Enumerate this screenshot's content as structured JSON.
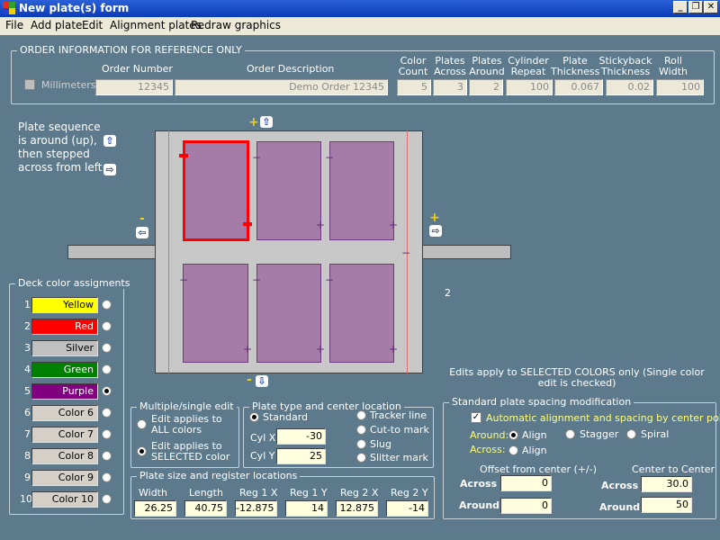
{
  "window": {
    "title": "New plate(s) form",
    "min": "_",
    "max": "❐",
    "close": "✕"
  },
  "menu": [
    "File",
    "Add plate",
    "Edit",
    "Alignment plates",
    "Redraw graphics"
  ],
  "order": {
    "group_title": "ORDER INFORMATION FOR REFERENCE ONLY",
    "millimeters_label": "Millimeters",
    "millimeters_checked": false,
    "order_number_label": "Order Number",
    "order_number": "12345",
    "order_description_label": "Order Description",
    "order_description": "Demo Order 12345",
    "color_count_label": "Color Count",
    "color_count": "5",
    "plates_across_label": "Plates Across",
    "plates_across": "3",
    "plates_around_label": "Plates Around",
    "plates_around": "2",
    "cylinder_repeat_label": "Cylinder Repeat",
    "cylinder_repeat": "100",
    "plate_thickness_label": "Plate Thickness",
    "plate_thickness": "0.067",
    "stickyback_thickness_label": "Stickyback Thickness",
    "stickyback_thickness": "0.02",
    "roll_width_label": "Roll Width",
    "roll_width": "100"
  },
  "sequence_text": [
    "Plate sequence",
    "is around (up),",
    "then stepped",
    "across from left"
  ],
  "canvas": {
    "plus_top": "+",
    "minus_left": "-",
    "plus_right": "+",
    "minus_bottom": "-",
    "side_number": "2"
  },
  "deck": {
    "title": "Deck color assigments",
    "rows": [
      {
        "num": "1",
        "name": "Yellow",
        "color": "#ffff00",
        "text_color": "#000000",
        "selected": false
      },
      {
        "num": "2",
        "name": "Red",
        "color": "#ff0000",
        "text_color": "#ffffff",
        "selected": false
      },
      {
        "num": "3",
        "name": "Silver",
        "color": "#c0c0c0",
        "text_color": "#000000",
        "selected": false
      },
      {
        "num": "4",
        "name": "Green",
        "color": "#008000",
        "text_color": "#ffffff",
        "selected": false
      },
      {
        "num": "5",
        "name": "Purple",
        "color": "#800080",
        "text_color": "#ffffff",
        "selected": true
      },
      {
        "num": "6",
        "name": "Color 6",
        "color": "#d4d0c8",
        "text_color": "#000000",
        "selected": false
      },
      {
        "num": "7",
        "name": "Color 7",
        "color": "#d4d0c8",
        "text_color": "#000000",
        "selected": false
      },
      {
        "num": "8",
        "name": "Color 8",
        "color": "#d4d0c8",
        "text_color": "#000000",
        "selected": false
      },
      {
        "num": "9",
        "name": "Color 9",
        "color": "#d4d0c8",
        "text_color": "#000000",
        "selected": false
      },
      {
        "num": "10",
        "name": "Color 10",
        "color": "#d4d0c8",
        "text_color": "#000000",
        "selected": false
      }
    ]
  },
  "edits_note": "Edits apply to SELECTED COLORS only (Single color edit is checked)",
  "multi_edit": {
    "title": "Multiple/single edit",
    "opt_all": "Edit applies to ALL colors",
    "opt_selected": "Edit applies to SELECTED color",
    "selected": "selected"
  },
  "plate_type": {
    "title": "Plate type and center location",
    "standard": "Standard",
    "tracker": "Tracker line",
    "cut_to_mark": "Cut-to mark",
    "slug": "Slug",
    "slitter": "Slitter mark",
    "cyl_x_label": "Cyl X",
    "cyl_x": "-30",
    "cyl_y_label": "Cyl Y",
    "cyl_y": "25"
  },
  "spacing": {
    "title": "Standard plate spacing modification",
    "auto_label": "Automatic alignment and spacing by center point",
    "auto_checked": true,
    "around_label": "Around:",
    "align": "Align",
    "stagger": "Stagger",
    "spiral": "Spiral",
    "across_label": "Across:",
    "offset_title": "Offset from center  (+/-)",
    "c2c_title": "Center to Center",
    "across": "Across",
    "around": "Around",
    "offset_across": "0",
    "offset_around": "0",
    "c2c_across": "30.0",
    "c2c_around": "50"
  },
  "size": {
    "title": "Plate size and register locations",
    "headers": [
      "Width",
      "Length",
      "Reg 1 X",
      "Reg 1 Y",
      "Reg 2 X",
      "Reg 2 Y"
    ],
    "values": [
      "26.25",
      "40.75",
      "-12.875",
      "14",
      "12.875",
      "-14"
    ]
  }
}
